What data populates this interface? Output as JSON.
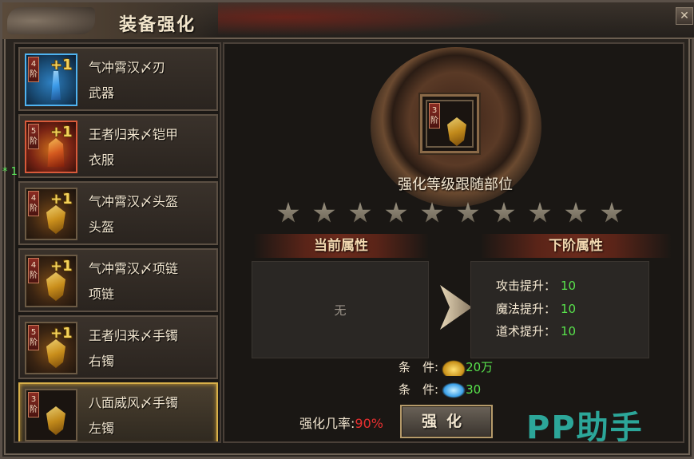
{
  "window": {
    "title": "装备强化"
  },
  "equipment_list": [
    {
      "tier": "4阶",
      "plus": "+1",
      "name": "气冲霄汉〆刃",
      "slot": "武器",
      "frame": "blue"
    },
    {
      "tier": "5阶",
      "plus": "+1",
      "name": "王者归来〆铠甲",
      "slot": "衣服",
      "frame": "red"
    },
    {
      "tier": "4阶",
      "plus": "+1",
      "name": "气冲霄汉〆头盔",
      "slot": "头盔",
      "frame": "gold"
    },
    {
      "tier": "4阶",
      "plus": "+1",
      "name": "气冲霄汉〆项链",
      "slot": "项链",
      "frame": "gold"
    },
    {
      "tier": "5阶",
      "plus": "+1",
      "name": "王者归来〆手镯",
      "slot": "右镯",
      "frame": "gold"
    },
    {
      "tier": "3阶",
      "plus": "",
      "name": "八面威风〆手镯",
      "slot": "左镯",
      "frame": "gold",
      "selected": true
    }
  ],
  "side_marker": "* 1",
  "detail": {
    "selected_tier": "3阶",
    "follow_text": "强化等级跟随部位",
    "stars_total": 10,
    "stars_lit": 0,
    "current_header": "当前属性",
    "next_header": "下阶属性",
    "current_none": "无",
    "next_stats": [
      {
        "label": "攻击提升：",
        "value": "10"
      },
      {
        "label": "魔法提升：",
        "value": "10"
      },
      {
        "label": "道术提升：",
        "value": "10"
      }
    ],
    "conditions": [
      {
        "label": "条　件:",
        "icon": "gold-ingot-icon",
        "value": "20万"
      },
      {
        "label": "条　件:",
        "icon": "crystal-icon",
        "value": "30"
      }
    ],
    "rate_label": "强化几率:",
    "rate_value": "90%",
    "enhance_button": "强化"
  },
  "watermark": "PP助手"
}
